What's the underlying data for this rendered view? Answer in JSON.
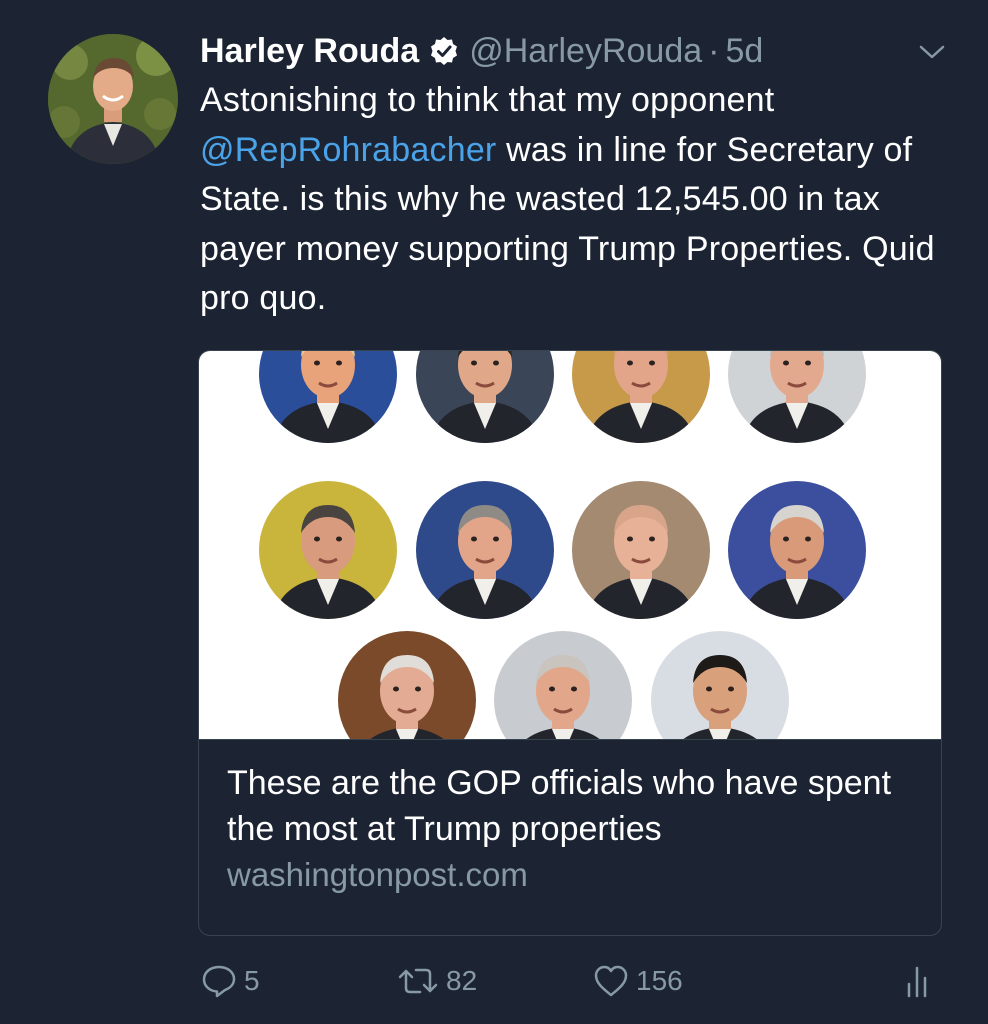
{
  "tweet": {
    "author_name": "Harley Rouda",
    "handle": "@HarleyRouda",
    "separator": "·",
    "time": "5d",
    "text_before": "Astonishing to think that my opponent ",
    "mention": "@RepRohrabacher",
    "text_after": " was in line for Secretary of State. is this why he wasted 12,545.00 in tax payer money supporting Trump Properties. Quid pro quo."
  },
  "card": {
    "title": "These are the GOP officials who have spent the most at Trump properties",
    "domain": "washingtonpost.com",
    "faces": [
      {
        "bg": "#2b4e9a",
        "skin": "#e8a37a",
        "hair": "#e9c98a"
      },
      {
        "bg": "#3a4658",
        "skin": "#e0a888",
        "hair": "#2a2522"
      },
      {
        "bg": "#c79a4a",
        "skin": "#e2a58a",
        "hair": "#d9a080"
      },
      {
        "bg": "#cfd3d6",
        "skin": "#e3a98f",
        "hair": "#b9b6b2"
      },
      {
        "bg": "#c9b43c",
        "skin": "#d99b7d",
        "hair": "#4a4440"
      },
      {
        "bg": "#2f4a8a",
        "skin": "#e2a58a",
        "hair": "#8e8a86"
      },
      {
        "bg": "#a38a70",
        "skin": "#e6b196",
        "hair": "#d9a58a"
      },
      {
        "bg": "#3b4f9e",
        "skin": "#d89a78",
        "hair": "#d7d3cf"
      },
      {
        "bg": "#7a4a2a",
        "skin": "#e3ab93",
        "hair": "#e0ddd8"
      },
      {
        "bg": "#c8ccd0",
        "skin": "#e2a78a",
        "hair": "#c9c4bd"
      },
      {
        "bg": "#d8dde3",
        "skin": "#d9a07c",
        "hair": "#1e1a18"
      }
    ]
  },
  "actions": {
    "reply_count": "5",
    "retweet_count": "82",
    "like_count": "156"
  },
  "colors": {
    "background": "#1c2433",
    "link": "#4aa3e8",
    "secondary_text": "#8899a6",
    "border": "#38444d"
  }
}
